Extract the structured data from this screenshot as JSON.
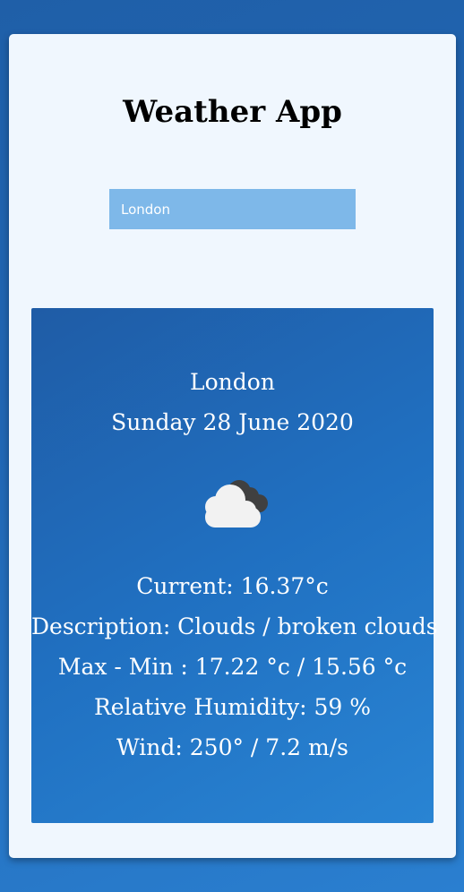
{
  "app": {
    "title": "Weather App"
  },
  "search": {
    "value": "London"
  },
  "weather": {
    "city": "London",
    "date": "Sunday 28 June 2020",
    "icon": "broken-clouds-icon",
    "current": "Current: 16.37°c",
    "description": "Description: Clouds / broken clouds",
    "max_min": "Max - Min : 17.22 °c / 15.56 °c",
    "humidity": "Relative Humidity: 59 %",
    "wind": "Wind: 250° / 7.2 m/s"
  }
}
